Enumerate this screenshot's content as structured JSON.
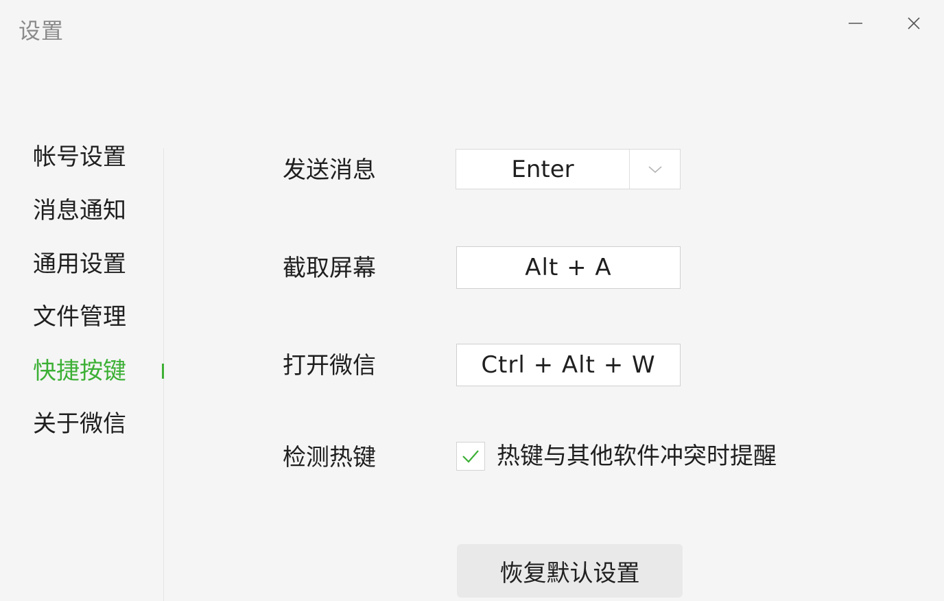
{
  "window": {
    "title": "设置",
    "minimize_icon": "minimize-icon",
    "close_icon": "close-icon"
  },
  "colors": {
    "accent": "#3cb035",
    "background": "#f5f5f5",
    "text": "#1f1f1f",
    "title_text": "#8a8a8a",
    "button_bg": "#e9e9e9"
  },
  "sidebar": {
    "items": [
      {
        "label": "帐号设置",
        "active": false
      },
      {
        "label": "消息通知",
        "active": false
      },
      {
        "label": "通用设置",
        "active": false
      },
      {
        "label": "文件管理",
        "active": false
      },
      {
        "label": "快捷按键",
        "active": true
      },
      {
        "label": "关于微信",
        "active": false
      }
    ]
  },
  "shortcuts": {
    "send_message": {
      "label": "发送消息",
      "value": "Enter",
      "icon": "chevron-down-icon"
    },
    "screenshot": {
      "label": "截取屏幕",
      "value": "Alt + A"
    },
    "open_wechat": {
      "label": "打开微信",
      "value": "Ctrl + Alt + W"
    },
    "detect_hotkey": {
      "label": "检测热键",
      "checked": true,
      "checkbox_label": "热键与其他软件冲突时提醒",
      "icon": "checkmark-icon"
    },
    "restore_label": "恢复默认设置"
  }
}
